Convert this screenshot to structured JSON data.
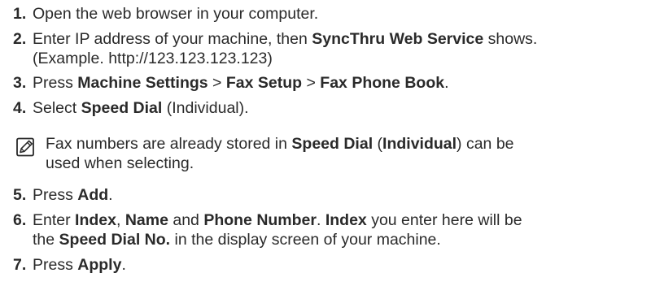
{
  "steps": [
    {
      "number": "1.",
      "lines": [
        [
          {
            "t": "Open the web browser in your computer.",
            "b": false
          }
        ]
      ]
    },
    {
      "number": "2.",
      "lines": [
        [
          {
            "t": "Enter IP address of your machine, then ",
            "b": false
          },
          {
            "t": "SyncThru Web Service",
            "b": true
          },
          {
            "t": " shows.",
            "b": false
          }
        ],
        [
          {
            "t": "(Example. http://123.123.123.123)",
            "b": false
          }
        ]
      ]
    },
    {
      "number": "3.",
      "lines": [
        [
          {
            "t": "Press ",
            "b": false
          },
          {
            "t": "Machine Settings",
            "b": true
          },
          {
            "t": " > ",
            "b": false
          },
          {
            "t": "Fax Setup",
            "b": true
          },
          {
            "t": " > ",
            "b": false
          },
          {
            "t": "Fax Phone Book",
            "b": true
          },
          {
            "t": ".",
            "b": false
          }
        ]
      ]
    },
    {
      "number": "4.",
      "lines": [
        [
          {
            "t": "Select ",
            "b": false
          },
          {
            "t": "Speed Dial",
            "b": true
          },
          {
            "t": " (Individual).",
            "b": false
          }
        ]
      ]
    },
    {
      "number": "5.",
      "lines": [
        [
          {
            "t": "Press ",
            "b": false
          },
          {
            "t": "Add",
            "b": true
          },
          {
            "t": ".",
            "b": false
          }
        ]
      ]
    },
    {
      "number": "6.",
      "lines": [
        [
          {
            "t": "Enter ",
            "b": false
          },
          {
            "t": "Index",
            "b": true
          },
          {
            "t": ", ",
            "b": false
          },
          {
            "t": "Name",
            "b": true
          },
          {
            "t": " and ",
            "b": false
          },
          {
            "t": "Phone Number",
            "b": true
          },
          {
            "t": ". ",
            "b": false
          },
          {
            "t": "Index",
            "b": true
          },
          {
            "t": " you enter here will be",
            "b": false
          }
        ],
        [
          {
            "t": "the ",
            "b": false
          },
          {
            "t": "Speed Dial No.",
            "b": true
          },
          {
            "t": " in the display screen of your machine.",
            "b": false
          }
        ]
      ]
    },
    {
      "number": "7.",
      "lines": [
        [
          {
            "t": "Press ",
            "b": false
          },
          {
            "t": "Apply",
            "b": true
          },
          {
            "t": ".",
            "b": false
          }
        ]
      ]
    }
  ],
  "note": {
    "icon": "note-pencil-icon",
    "lines": [
      [
        {
          "t": "Fax numbers are already stored in ",
          "b": false
        },
        {
          "t": "Speed Dial",
          "b": true
        },
        {
          "t": " (",
          "b": false
        },
        {
          "t": "Individual",
          "b": true
        },
        {
          "t": ") can be",
          "b": false
        }
      ],
      [
        {
          "t": "used when selecting.",
          "b": false
        }
      ]
    ]
  }
}
